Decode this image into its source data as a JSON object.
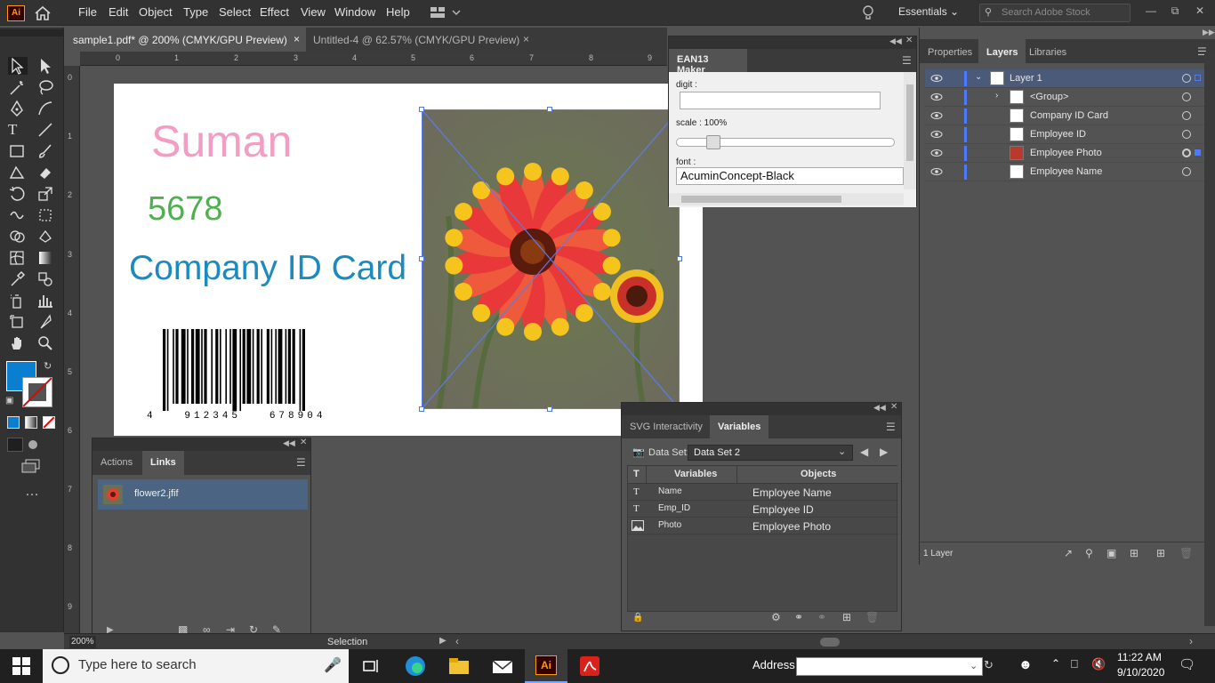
{
  "menubar": {
    "logo": "Ai",
    "items": [
      "File",
      "Edit",
      "Object",
      "Type",
      "Select",
      "Effect",
      "View",
      "Window",
      "Help"
    ],
    "workspace": "Essentials",
    "search_placeholder": "Search Adobe Stock"
  },
  "tabs": [
    {
      "label": "sample1.pdf* @ 200% (CMYK/GPU Preview)",
      "close": "×"
    },
    {
      "label": "Untitled-4 @ 62.57% (CMYK/GPU Preview)",
      "close": "×"
    }
  ],
  "rulers": {
    "h": [
      "0",
      "1",
      "2",
      "3",
      "4",
      "5",
      "6",
      "7",
      "8",
      "9"
    ],
    "v": [
      "0",
      "1",
      "2",
      "3",
      "4",
      "5",
      "6",
      "7",
      "8",
      "9"
    ]
  },
  "artboard": {
    "name_text": "Suman",
    "id_text": "5678",
    "company_text": "Company ID Card",
    "barcode_digits": "4   912345   678904",
    "colors": {
      "name": "#f29ec4",
      "id": "#4fb04f",
      "company": "#1b8bbf"
    }
  },
  "ean13": {
    "title": "EAN13 Maker",
    "digit_label": "digit :",
    "digit_value": "",
    "scale_label": "scale : 100%",
    "scale_value": 1.0,
    "font_label": "font :",
    "font_value": "AcuminConcept-Black"
  },
  "layers_panel": {
    "tabs": [
      "Properties",
      "Layers",
      "Libraries"
    ],
    "active_tab": "Layers",
    "rows": [
      {
        "name": "Layer 1"
      },
      {
        "name": "<Group>"
      },
      {
        "name": "Company ID Card"
      },
      {
        "name": "Employee ID"
      },
      {
        "name": "Employee Photo"
      },
      {
        "name": "Employee Name"
      }
    ],
    "footer": "1 Layer"
  },
  "links_panel": {
    "tabs": [
      "Actions",
      "Links"
    ],
    "active_tab": "Links",
    "items": [
      {
        "name": "flower2.jfif"
      }
    ]
  },
  "variables_panel": {
    "tabs": [
      "SVG Interactivity",
      "Variables"
    ],
    "active_tab": "Variables",
    "dataset_label": "Data Set:",
    "dataset_value": "Data Set 2",
    "headers": [
      "T",
      "Variables",
      "Objects"
    ],
    "rows": [
      {
        "type": "T",
        "variable": "Name",
        "object": "Employee Name"
      },
      {
        "type": "T",
        "variable": "Emp_ID",
        "object": "Employee ID"
      },
      {
        "type": "img",
        "variable": "Photo",
        "object": "Employee Photo"
      }
    ]
  },
  "statusbar": {
    "zoom": "200%",
    "tool": "Selection"
  },
  "taskbar": {
    "search_placeholder": "Type here to search",
    "address_label": "Address",
    "time": "11:22 AM",
    "date": "9/10/2020"
  }
}
